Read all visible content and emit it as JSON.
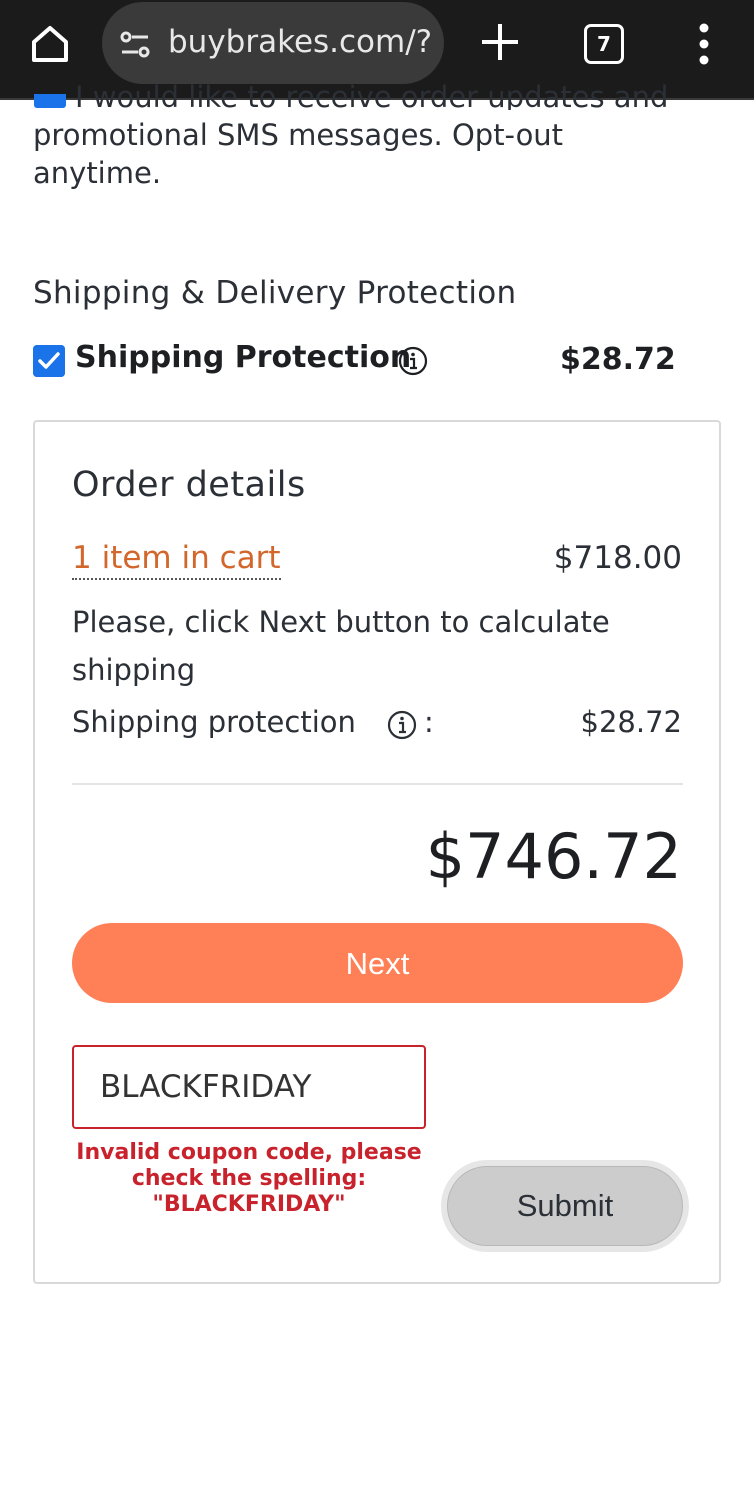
{
  "browser": {
    "url": "buybrakes.com/?",
    "tab_count": "7"
  },
  "sms_optin": {
    "cut_text": "I would like to receive order updates and",
    "text": "promotional SMS messages. Opt-out anytime."
  },
  "shipping_section": {
    "title": "Shipping & Delivery Protection",
    "label": "Shipping Protection",
    "price": "$28.72"
  },
  "order": {
    "title": "Order details",
    "items_link": "1 item in cart",
    "items_price": "$718.00",
    "note": "Please, click Next button to calculate shipping",
    "protection_label": "Shipping protection",
    "protection_colon": ":",
    "protection_price": "$28.72",
    "total": "$746.72",
    "next_label": "Next"
  },
  "coupon": {
    "value": "BLACKFRIDAY",
    "error": "Invalid coupon code, please check the spelling: \"BLACKFRIDAY\"",
    "submit_label": "Submit"
  },
  "colors": {
    "accent_orange": "#ff7f56",
    "link_orange": "#d2662b",
    "error_red": "#c8232c",
    "checkbox_blue": "#1a73e8"
  },
  "icons": [
    "home-icon",
    "site-settings-icon",
    "new-tab-plus-icon",
    "tab-switcher-icon",
    "more-vert-icon",
    "info-icon",
    "checkbox-checked-icon"
  ]
}
